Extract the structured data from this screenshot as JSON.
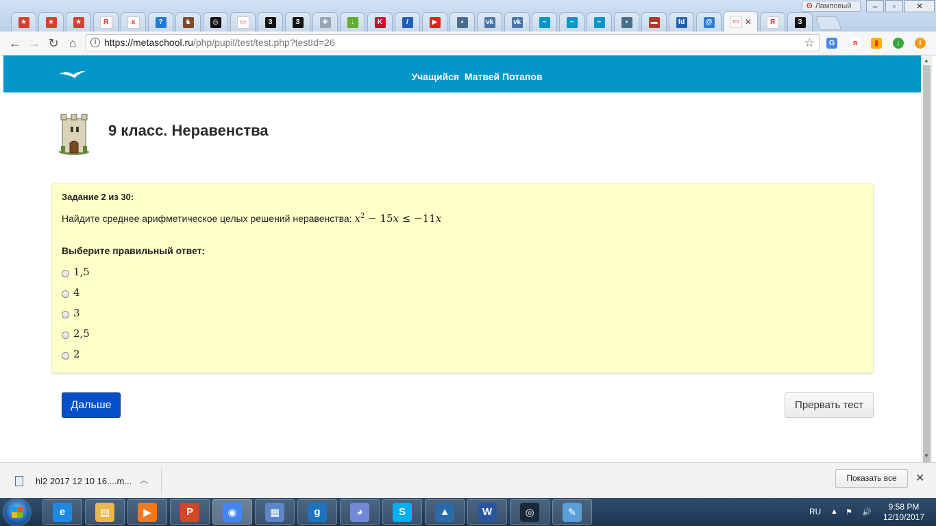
{
  "browser": {
    "tabs": [
      {
        "icon": "mos-ru-icon",
        "color": "#d4412e",
        "glyph": "★"
      },
      {
        "icon": "mos-ru-icon",
        "color": "#d4412e",
        "glyph": "★"
      },
      {
        "icon": "mos-ru-icon",
        "color": "#d4412e",
        "glyph": "★"
      },
      {
        "icon": "yandex-icon",
        "color": "#ffffff",
        "glyph": "Я"
      },
      {
        "icon": "xhtml-icon",
        "color": "#ffffff",
        "glyph": "x"
      },
      {
        "icon": "help-icon",
        "color": "#1e7bd6",
        "glyph": "?"
      },
      {
        "icon": "game-icon",
        "color": "#7a4a2a",
        "glyph": "♞"
      },
      {
        "icon": "steam-icon",
        "color": "#111111",
        "glyph": "◎"
      },
      {
        "icon": "page-icon",
        "color": "#ffffff",
        "glyph": "▭"
      },
      {
        "icon": "z-icon",
        "color": "#111111",
        "glyph": "З"
      },
      {
        "icon": "z-icon",
        "color": "#111111",
        "glyph": "З"
      },
      {
        "icon": "puzzle-icon",
        "color": "#9aa5b1",
        "glyph": "✚"
      },
      {
        "icon": "download-icon",
        "color": "#5fae2e",
        "glyph": "↓"
      },
      {
        "icon": "k-icon",
        "color": "#c8102e",
        "glyph": "K"
      },
      {
        "icon": "slash-icon",
        "color": "#1f5fb8",
        "glyph": "/"
      },
      {
        "icon": "youtube-icon",
        "color": "#e62117",
        "glyph": "▶"
      },
      {
        "icon": "chat-icon",
        "color": "#4a6d8c",
        "glyph": "▪"
      },
      {
        "icon": "vk-icon",
        "color": "#4a76a8",
        "glyph": "vk"
      },
      {
        "icon": "vk-icon",
        "color": "#4a76a8",
        "glyph": "vk"
      },
      {
        "icon": "metaschool-icon",
        "color": "#0596c9",
        "glyph": "~"
      },
      {
        "icon": "metaschool-icon",
        "color": "#0596c9",
        "glyph": "~"
      },
      {
        "icon": "metaschool-icon",
        "color": "#0596c9",
        "glyph": "~"
      },
      {
        "icon": "chat-icon",
        "color": "#4a6d8c",
        "glyph": "▪"
      },
      {
        "icon": "book-icon",
        "color": "#b33a2b",
        "glyph": "▬"
      },
      {
        "icon": "fd-icon",
        "color": "#1f5fb8",
        "glyph": "fd"
      },
      {
        "icon": "mail-icon",
        "color": "#2e7fd1",
        "glyph": "@"
      },
      {
        "icon": "page-icon",
        "color": "#ffffff",
        "glyph": "▭",
        "active": true,
        "close": "✕"
      },
      {
        "icon": "yandex-icon",
        "color": "#ffffff",
        "glyph": "Я"
      },
      {
        "icon": "z-icon",
        "color": "#111111",
        "glyph": "З"
      }
    ],
    "profile_name": "Ламповый",
    "url_host": "https://metaschool.ru",
    "url_path": "/php/pupil/test/test.php?testId=26"
  },
  "page": {
    "user_prefix": "Учащийся",
    "user_name": "Матвей Потапов",
    "test_title": "9 класс. Неравенства",
    "task_counter": "Задание 2 из 30:",
    "task_text": "Найдите среднее арифметическое целых решений неравенства:",
    "inequality": {
      "lhs_var": "x",
      "lhs_exp": "2",
      "lhs_rest": "− 15",
      "lhs_var2": "x",
      "rel": "≤",
      "rhs": "−11",
      "rhs_var": "x"
    },
    "answer_prompt": "Выберите правильный ответ:",
    "options": [
      "1,5",
      "4",
      "3",
      "2,5",
      "2"
    ],
    "next_label": "Дальше",
    "abort_label": "Прервать тест"
  },
  "downloads": {
    "file_name": "hl2 2017 12 10 16....m...",
    "show_all": "Показать все"
  },
  "taskbar": {
    "lang": "RU",
    "time": "9:58 PM",
    "date": "12/10/2017",
    "apps": [
      {
        "name": "ie-icon",
        "color": "#1e88e5",
        "glyph": "e"
      },
      {
        "name": "explorer-icon",
        "color": "#e8b84a",
        "glyph": "▤"
      },
      {
        "name": "media-player-icon",
        "color": "#f07a20",
        "glyph": "▶"
      },
      {
        "name": "powerpoint-icon",
        "color": "#d24726",
        "glyph": "P"
      },
      {
        "name": "chrome-icon",
        "color": "#4285f4",
        "glyph": "◉",
        "active": true
      },
      {
        "name": "control-panel-icon",
        "color": "#5b87c7",
        "glyph": "▦"
      },
      {
        "name": "gmod-icon",
        "color": "#1e73be",
        "glyph": "g"
      },
      {
        "name": "discord-icon",
        "color": "#7289da",
        "glyph": "◕"
      },
      {
        "name": "skype-icon",
        "color": "#00aff0",
        "glyph": "S"
      },
      {
        "name": "app-icon",
        "color": "#2b6aa8",
        "glyph": "▲"
      },
      {
        "name": "word-icon",
        "color": "#2b579a",
        "glyph": "W"
      },
      {
        "name": "steam-icon",
        "color": "#1b2838",
        "glyph": "◎"
      },
      {
        "name": "paint-icon",
        "color": "#5aa0d8",
        "glyph": "✎"
      }
    ]
  }
}
